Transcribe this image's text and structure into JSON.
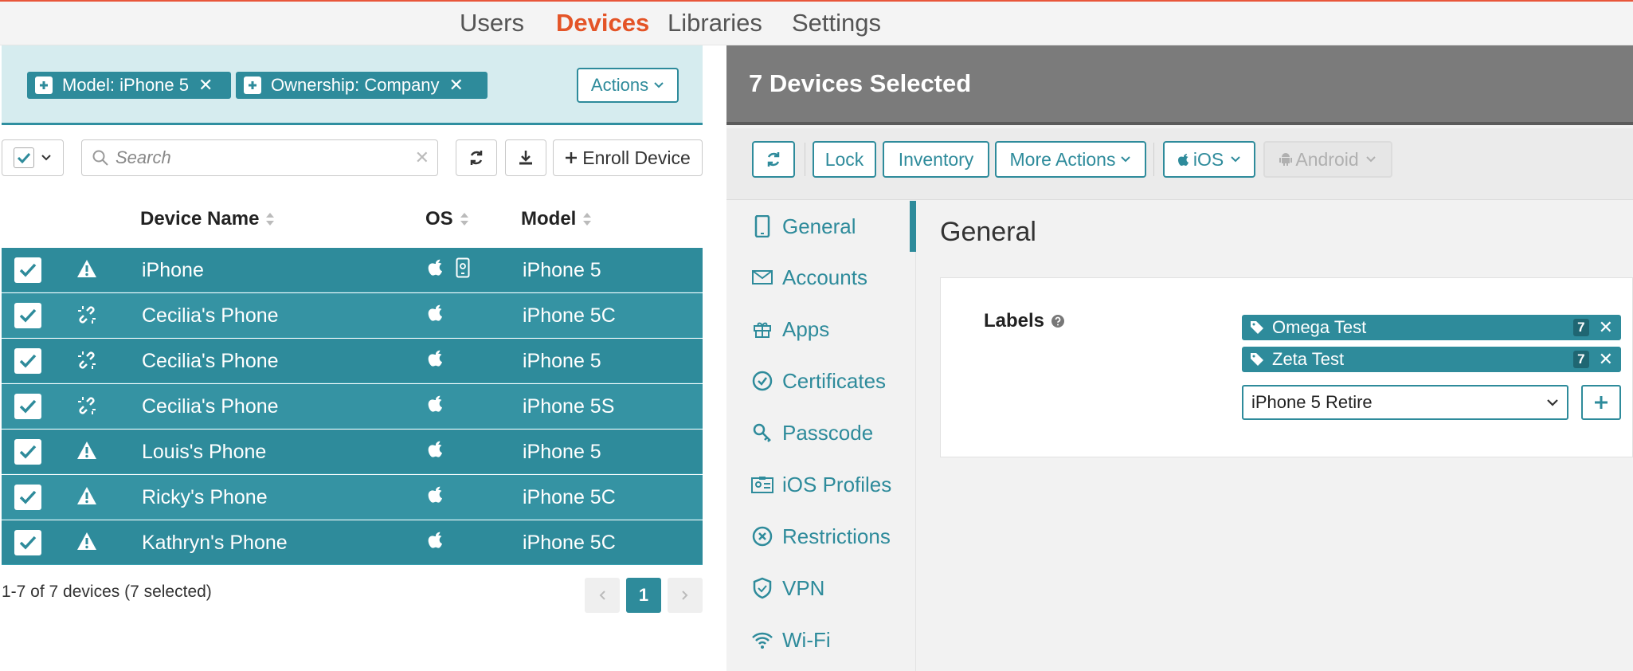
{
  "nav": {
    "users": "Users",
    "devices": "Devices",
    "libraries": "Libraries",
    "settings": "Settings"
  },
  "filters": {
    "chips": [
      "Model: iPhone 5",
      "Ownership: Company"
    ],
    "actions_label": "Actions"
  },
  "toolbar": {
    "search_placeholder": "Search",
    "enroll_label": "Enroll Device"
  },
  "table": {
    "columns": {
      "name": "Device Name",
      "os": "OS",
      "model": "Model"
    },
    "rows": [
      {
        "name": "iPhone",
        "model": "iPhone 5",
        "status": "warning-icon"
      },
      {
        "name": "Cecilia's Phone",
        "model": "iPhone 5C",
        "status": "broken-link-icon"
      },
      {
        "name": "Cecilia's Phone",
        "model": "iPhone 5",
        "status": "broken-link-icon"
      },
      {
        "name": "Cecilia's Phone",
        "model": "iPhone 5S",
        "status": "broken-link-icon"
      },
      {
        "name": "Louis's Phone",
        "model": "iPhone 5",
        "status": "warning-icon"
      },
      {
        "name": "Ricky's Phone",
        "model": "iPhone 5C",
        "status": "warning-icon"
      },
      {
        "name": "Kathryn's Phone",
        "model": "iPhone 5C",
        "status": "warning-icon"
      }
    ],
    "footer": "1-7 of 7 devices (7 selected)",
    "current_page": "1"
  },
  "detail": {
    "title": "7 Devices Selected",
    "actions": {
      "lock": "Lock",
      "inventory": "Inventory",
      "more": "More Actions",
      "ios": "iOS",
      "android": "Android"
    },
    "sidenav": [
      "General",
      "Accounts",
      "Apps",
      "Certificates",
      "Passcode",
      "iOS Profiles",
      "Restrictions",
      "VPN",
      "Wi-Fi"
    ],
    "section_title": "General",
    "labels_title": "Labels",
    "labels": [
      {
        "name": "Omega Test",
        "count": "7"
      },
      {
        "name": "Zeta Test",
        "count": "7"
      }
    ],
    "label_input_value": "iPhone 5 Retire"
  },
  "colors": {
    "accent": "#2e8b9b",
    "active_nav": "#e45427",
    "header_gray": "#7b7b7b"
  }
}
